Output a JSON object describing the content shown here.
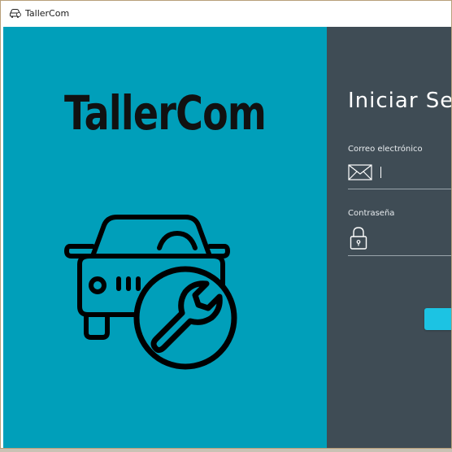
{
  "window": {
    "title": "TallerCom",
    "app_icon": "car-wrench-icon"
  },
  "branding": {
    "logo_text": "TallerCom",
    "illustration": "car-wrench-icon",
    "panel_color": "#009fba"
  },
  "login": {
    "title": "Iniciar Se",
    "panel_color": "#3f4c55",
    "email": {
      "label": "Correo electrónico",
      "icon": "envelope-icon",
      "value": ""
    },
    "password": {
      "label": "Contraseña",
      "icon": "lock-icon",
      "value": ""
    },
    "button": {
      "label": "",
      "color": "#1cc3e3"
    }
  }
}
